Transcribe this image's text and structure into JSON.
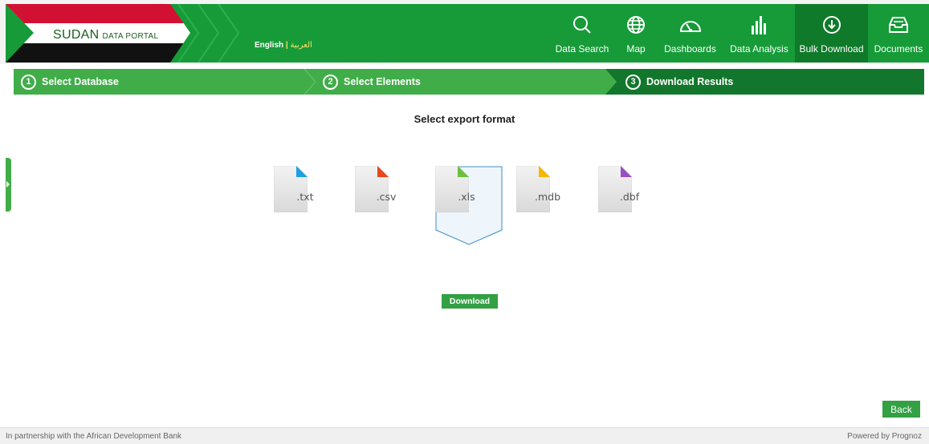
{
  "header": {
    "logo_main": "SUDAN",
    "logo_sub": "DATA PORTAL",
    "lang_english": "English",
    "lang_sep": "|",
    "lang_arabic": "العربية",
    "nav": [
      {
        "label": "Data Search",
        "icon": "search-icon"
      },
      {
        "label": "Map",
        "icon": "globe-icon"
      },
      {
        "label": "Dashboards",
        "icon": "gauge-icon"
      },
      {
        "label": "Data Analysis",
        "icon": "bar-chart-icon"
      },
      {
        "label": "Bulk Download",
        "icon": "download-circle-icon",
        "active": true
      },
      {
        "label": "Documents",
        "icon": "inbox-tray-icon"
      }
    ]
  },
  "steps": [
    {
      "num": "1",
      "label": "Select Database"
    },
    {
      "num": "2",
      "label": "Select Elements"
    },
    {
      "num": "3",
      "label": "Download Results"
    }
  ],
  "main": {
    "title": "Select export format",
    "formats": [
      {
        "label": ".txt",
        "color": "#1ea0e0",
        "selected": false
      },
      {
        "label": ".csv",
        "color": "#e8461b",
        "selected": false
      },
      {
        "label": ".xls",
        "color": "#6cbf3f",
        "selected": true
      },
      {
        "label": ".mdb",
        "color": "#f5b800",
        "selected": false
      },
      {
        "label": ".dbf",
        "color": "#9b4ec2",
        "selected": false
      }
    ],
    "download_label": "Download",
    "back_label": "Back"
  },
  "footer": {
    "left": "In partnership with the African Development Bank",
    "right": "Powered by Prognoz"
  },
  "colors": {
    "header_green": "#169b38",
    "steps_green": "#41ad49",
    "steps_dark": "#12772c",
    "button_green": "#33a043",
    "flag_red": "#d21034"
  }
}
